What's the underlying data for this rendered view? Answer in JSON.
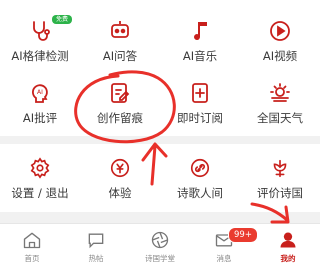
{
  "features_row1": [
    {
      "label": "AI格律检测",
      "icon": "stethoscope-icon",
      "badge": "免费"
    },
    {
      "label": "AI问答",
      "icon": "robot-icon"
    },
    {
      "label": "AI音乐",
      "icon": "music-note-icon"
    },
    {
      "label": "AI视频",
      "icon": "video-play-icon"
    }
  ],
  "features_row2": [
    {
      "label": "AI批评",
      "icon": "ai-head-icon"
    },
    {
      "label": "创作留痕",
      "icon": "edit-note-icon"
    },
    {
      "label": "即时订阅",
      "icon": "bookmark-add-icon"
    },
    {
      "label": "全国天气",
      "icon": "weather-icon"
    }
  ],
  "features_row3": [
    {
      "label": "设置 / 退出",
      "icon": "gear-icon"
    },
    {
      "label": "体验",
      "icon": "coin-icon"
    },
    {
      "label": "诗歌人间",
      "icon": "link-icon"
    },
    {
      "label": "评价诗国",
      "icon": "flower-icon"
    }
  ],
  "tabbar": [
    {
      "label": "首页",
      "icon": "home-icon"
    },
    {
      "label": "热帖",
      "icon": "chat-bubble-icon"
    },
    {
      "label": "诗国学堂",
      "icon": "aperture-icon"
    },
    {
      "label": "消息",
      "icon": "mail-icon",
      "badge": "99+"
    },
    {
      "label": "我的",
      "icon": "user-icon",
      "active": true
    }
  ],
  "colors": {
    "accent": "#c8201c",
    "badge_green": "#2db34a",
    "badge_red": "#ea3b2f",
    "annotation": "#e8302a"
  }
}
